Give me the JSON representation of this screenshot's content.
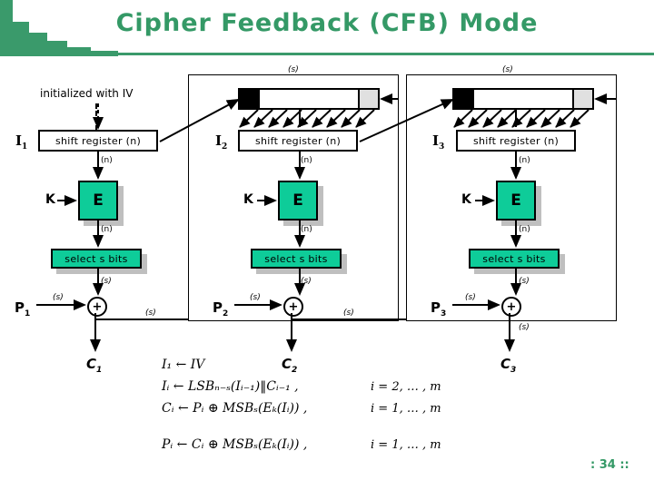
{
  "slide": {
    "title": "Cipher Feedback (CFB) Mode",
    "page_number": ": 34 ::",
    "accent_color": "#349966",
    "block_color": "#0ECC99",
    "shadow_color": "#bfbfbf"
  },
  "annotations": {
    "init_note": "initialized with IV",
    "shift_register_label": "shift register (n)",
    "select_label": "select s bits",
    "encrypt_label": "E",
    "key_label": "K",
    "width_n": "(n)",
    "width_s": "(s)",
    "xor_symbol": "+"
  },
  "stages": [
    {
      "id": "stage-1",
      "input_label": "I",
      "input_sub": "1",
      "plaintext_label": "P",
      "plaintext_sub": "1",
      "ciphertext_label": "C",
      "ciphertext_sub": "1",
      "register_label": "shift register (n)",
      "select_label": "select s bits",
      "encrypt_label": "E",
      "key_label": "K",
      "reg_out_width": "(n)",
      "sel_out_width": "(s)",
      "plain_in_width": "(s)",
      "feedback_width": "(s)"
    },
    {
      "id": "stage-2",
      "input_label": "I",
      "input_sub": "2",
      "plaintext_label": "P",
      "plaintext_sub": "2",
      "ciphertext_label": "C",
      "ciphertext_sub": "2",
      "register_label": "shift register (n)",
      "select_label": "select s bits",
      "encrypt_label": "E",
      "key_label": "K",
      "reg_out_width": "(n)",
      "sel_out_width": "(s)",
      "plain_in_width": "(s)",
      "feedback_width": "(s)",
      "top_feedback_width": "(s)"
    },
    {
      "id": "stage-3",
      "input_label": "I",
      "input_sub": "3",
      "plaintext_label": "P",
      "plaintext_sub": "3",
      "ciphertext_label": "C",
      "ciphertext_sub": "3",
      "register_label": "shift register (n)",
      "select_label": "select s bits",
      "encrypt_label": "E",
      "key_label": "K",
      "reg_out_width": "(n)",
      "sel_out_width": "(s)",
      "plain_in_width": "(s)",
      "feedback_width": "(s)",
      "top_feedback_width": "(s)"
    }
  ],
  "formulas": [
    {
      "text": "I₁ ← IV",
      "range": ""
    },
    {
      "text": "Iᵢ ← LSBₙ₋ₛ(Iᵢ₋₁)‖Cᵢ₋₁ ,",
      "range": "i = 2, … , m"
    },
    {
      "text": "Cᵢ ← Pᵢ ⊕ MSBₛ(Eₖ(Iᵢ)) ,",
      "range": "i = 1, … , m"
    },
    {
      "text": "Pᵢ ← Cᵢ ⊕ MSBₛ(Eₖ(Iᵢ)) ,",
      "range": "i = 1, … , m"
    }
  ]
}
